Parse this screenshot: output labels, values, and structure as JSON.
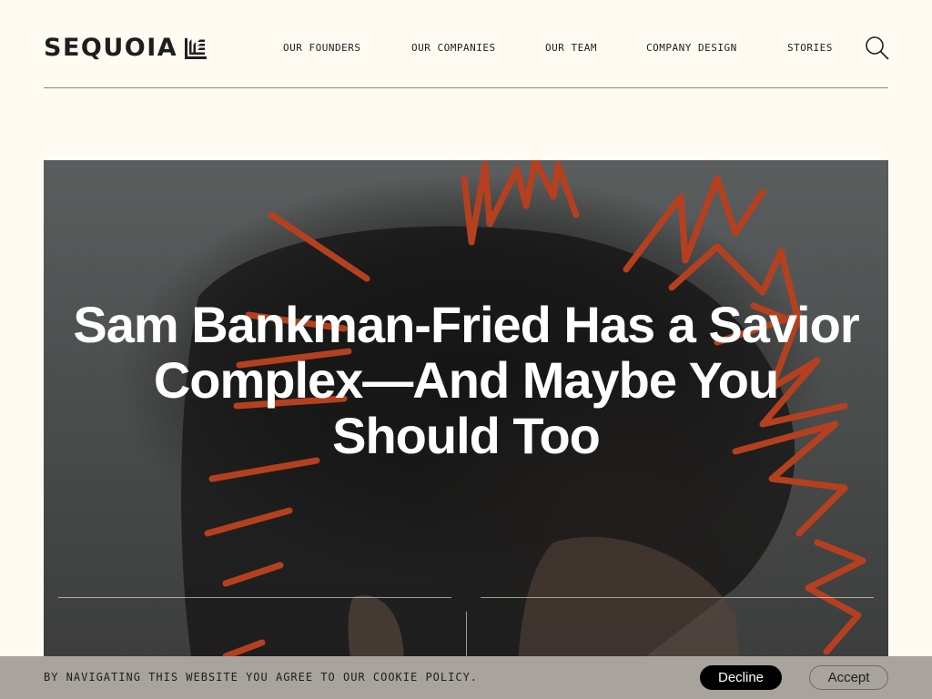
{
  "brand": {
    "name": "SEQUOIA",
    "logo_icon": "sequoia-leaf-mark-icon"
  },
  "nav": [
    {
      "label": "OUR FOUNDERS"
    },
    {
      "label": "OUR COMPANIES"
    },
    {
      "label": "OUR TEAM"
    },
    {
      "label": "COMPANY DESIGN"
    },
    {
      "label": "STORIES"
    }
  ],
  "search": {
    "icon": "search-icon"
  },
  "hero": {
    "title": "Sam Bankman-Fried Has a Savior Complex—And Maybe You Should Too",
    "accent_color": "#b5401f"
  },
  "cookie": {
    "text": "BY NAVIGATING THIS WEBSITE YOU AGREE TO OUR COOKIE POLICY.",
    "decline_label": "Decline",
    "accept_label": "Accept"
  },
  "colors": {
    "background": "#fffbf3",
    "text": "#1e1e1e",
    "cookie_bar": "#a8a39d"
  }
}
